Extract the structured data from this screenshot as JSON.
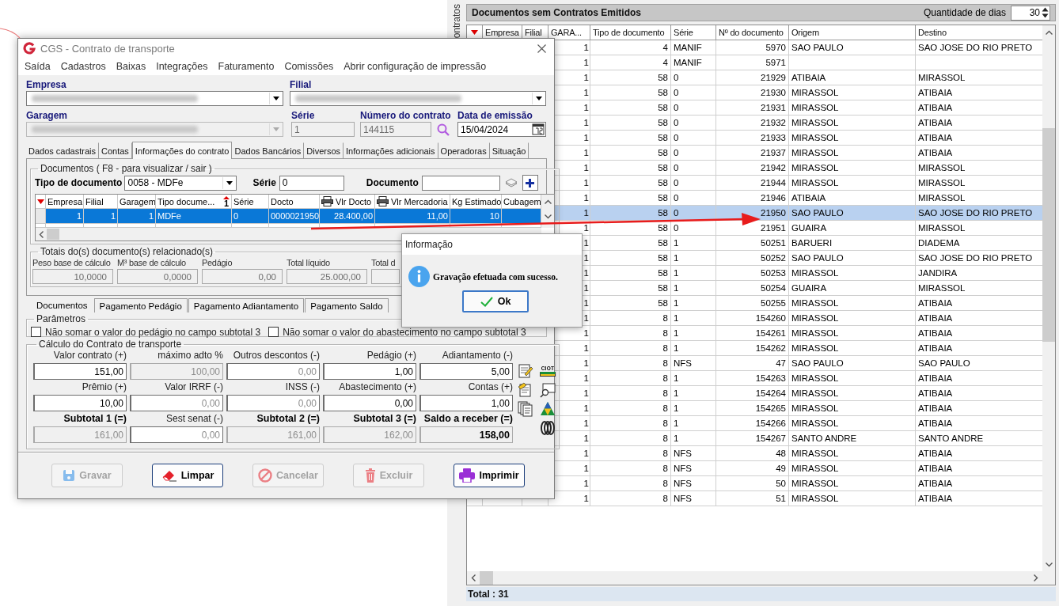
{
  "documents_window": {
    "side_label": "ontratos",
    "title": "Documentos sem Contratos Emitidos",
    "days_label": "Quantidade de dias",
    "days_value": "30",
    "columns": [
      "Empresa",
      "Filial",
      "GARA...",
      "Tipo de documento",
      "Série",
      "Nº do documento",
      "Origem",
      "Destino"
    ],
    "rows": [
      {
        "garagem": "1",
        "tipo": "4",
        "serie": "MANIF",
        "numero": "5970",
        "origem": "SAO PAULO",
        "destino": "SAO JOSE DO RIO PRETO",
        "selected": false
      },
      {
        "garagem": "1",
        "tipo": "4",
        "serie": "MANIF",
        "numero": "5971",
        "selected": false
      },
      {
        "garagem": "1",
        "tipo": "58",
        "serie": "0",
        "numero": "21929",
        "origem": "ATIBAIA",
        "destino": "MIRASSOL",
        "selected": false
      },
      {
        "garagem": "1",
        "tipo": "58",
        "serie": "0",
        "numero": "21930",
        "origem": "MIRASSOL",
        "destino": "ATIBAIA",
        "selected": false
      },
      {
        "garagem": "1",
        "tipo": "58",
        "serie": "0",
        "numero": "21931",
        "origem": "MIRASSOL",
        "destino": "ATIBAIA",
        "selected": false
      },
      {
        "garagem": "1",
        "tipo": "58",
        "serie": "0",
        "numero": "21932",
        "origem": "MIRASSOL",
        "destino": "ATIBAIA",
        "selected": false
      },
      {
        "garagem": "1",
        "tipo": "58",
        "serie": "0",
        "numero": "21933",
        "origem": "MIRASSOL",
        "destino": "ATIBAIA",
        "selected": false
      },
      {
        "garagem": "1",
        "tipo": "58",
        "serie": "0",
        "numero": "21937",
        "origem": "MIRASSOL",
        "destino": "ATIBAIA",
        "selected": false
      },
      {
        "garagem": "1",
        "tipo": "58",
        "serie": "0",
        "numero": "21942",
        "origem": "MIRASSOL",
        "destino": "MIRASSOL",
        "selected": false
      },
      {
        "garagem": "1",
        "tipo": "58",
        "serie": "0",
        "numero": "21944",
        "origem": "MIRASSOL",
        "destino": "MIRASSOL",
        "selected": false
      },
      {
        "garagem": "1",
        "tipo": "58",
        "serie": "0",
        "numero": "21946",
        "origem": "ATIBAIA",
        "destino": "MIRASSOL",
        "selected": false
      },
      {
        "garagem": "1",
        "tipo": "58",
        "serie": "0",
        "numero": "21950",
        "origem": "SAO PAULO",
        "destino": "SAO JOSE DO RIO PRETO",
        "selected": true
      },
      {
        "garagem": "1",
        "tipo": "58",
        "serie": "0",
        "numero": "21951",
        "origem": "GUAIRA",
        "destino": "MIRASSOL",
        "selected": false
      },
      {
        "garagem": "1",
        "tipo": "58",
        "serie": "1",
        "numero": "50251",
        "origem": "BARUERI",
        "destino": "DIADEMA",
        "selected": false
      },
      {
        "garagem": "1",
        "tipo": "58",
        "serie": "1",
        "numero": "50252",
        "origem": "SAO PAULO",
        "destino": "SAO JOSE DO RIO PRETO",
        "selected": false
      },
      {
        "garagem": "1",
        "tipo": "58",
        "serie": "1",
        "numero": "50253",
        "origem": "MIRASSOL",
        "destino": "JANDIRA",
        "selected": false
      },
      {
        "garagem": "1",
        "tipo": "58",
        "serie": "1",
        "numero": "50254",
        "origem": "GUAIRA",
        "destino": "MIRASSOL",
        "selected": false
      },
      {
        "garagem": "1",
        "tipo": "58",
        "serie": "1",
        "numero": "50255",
        "origem": "MIRASSOL",
        "destino": "ATIBAIA",
        "selected": false
      },
      {
        "garagem": "1",
        "tipo": "8",
        "serie": "1",
        "numero": "154260",
        "origem": "MIRASSOL",
        "destino": "ATIBAIA",
        "selected": false
      },
      {
        "garagem": "1",
        "tipo": "8",
        "serie": "1",
        "numero": "154261",
        "origem": "MIRASSOL",
        "destino": "ATIBAIA",
        "selected": false
      },
      {
        "garagem": "1",
        "tipo": "8",
        "serie": "1",
        "numero": "154262",
        "origem": "MIRASSOL",
        "destino": "ATIBAIA",
        "selected": false
      },
      {
        "garagem": "1",
        "tipo": "8",
        "serie": "NFS",
        "numero": "47",
        "origem": "SAO PAULO",
        "destino": "SAO PAULO",
        "selected": false
      },
      {
        "garagem": "1",
        "tipo": "8",
        "serie": "1",
        "numero": "154263",
        "origem": "MIRASSOL",
        "destino": "ATIBAIA",
        "selected": false
      },
      {
        "garagem": "1",
        "tipo": "8",
        "serie": "1",
        "numero": "154264",
        "origem": "MIRASSOL",
        "destino": "ATIBAIA",
        "selected": false
      },
      {
        "garagem": "1",
        "tipo": "8",
        "serie": "1",
        "numero": "154265",
        "origem": "MIRASSOL",
        "destino": "ATIBAIA",
        "selected": false
      },
      {
        "garagem": "1",
        "tipo": "8",
        "serie": "1",
        "numero": "154266",
        "origem": "MIRASSOL",
        "destino": "ATIBAIA",
        "selected": false
      },
      {
        "garagem": "1",
        "tipo": "8",
        "serie": "1",
        "numero": "154267",
        "origem": "SANTO ANDRE",
        "destino": "SANTO ANDRE",
        "selected": false
      },
      {
        "garagem": "1",
        "tipo": "8",
        "serie": "NFS",
        "numero": "48",
        "origem": "MIRASSOL",
        "destino": "ATIBAIA",
        "selected": false
      },
      {
        "garagem": "1",
        "tipo": "8",
        "serie": "NFS",
        "numero": "49",
        "origem": "MIRASSOL",
        "destino": "ATIBAIA",
        "selected": false
      },
      {
        "garagem": "1",
        "tipo": "8",
        "serie": "NFS",
        "numero": "50",
        "origem": "MIRASSOL",
        "destino": "ATIBAIA",
        "selected": false
      },
      {
        "garagem": "1",
        "tipo": "8",
        "serie": "NFS",
        "numero": "51",
        "origem": "MIRASSOL",
        "destino": "ATIBAIA",
        "selected": false
      }
    ],
    "total": "Total : 31"
  },
  "contract_window": {
    "title": "CGS - Contrato de transporte",
    "menu": [
      "Saída",
      "Cadastros",
      "Baixas",
      "Integrações",
      "Faturamento",
      "Comissões",
      "Abrir configuração de impressão"
    ],
    "header": {
      "empresa_label": "Empresa",
      "filial_label": "Filial",
      "garagem_label": "Garagem",
      "serie_label": "Série",
      "serie_value": "1",
      "numero_label": "Número do contrato",
      "numero_value": "144115",
      "data_label": "Data de emissão",
      "data_value": "15/04/2024"
    },
    "tabs": [
      {
        "label": "Dados cadastrais",
        "selected": false
      },
      {
        "label": "Contas",
        "selected": false
      },
      {
        "label": "Informações do contrato",
        "selected": true
      },
      {
        "label": "Dados Bancários",
        "selected": false
      },
      {
        "label": "Diversos",
        "selected": false
      },
      {
        "label": "Informações adicionais",
        "selected": false
      },
      {
        "label": "Operadoras",
        "selected": false
      },
      {
        "label": "Situação",
        "selected": false
      }
    ],
    "documentos": {
      "legend": "Documentos ( F8 - para visualizar / sair )",
      "tipo_label": "Tipo de documento",
      "tipo_value": "0058 - MDFe",
      "serie_label": "Série",
      "serie_value": "0",
      "documento_label": "Documento"
    },
    "grid": {
      "columns": [
        {
          "label": "Empresa",
          "kind": "plain"
        },
        {
          "label": "Filial",
          "kind": "plain"
        },
        {
          "label": "Garagem",
          "kind": "plain"
        },
        {
          "label": "Tipo docume...",
          "kind": "sorted",
          "sort_mark": "1"
        },
        {
          "label": "Série",
          "kind": "plain"
        },
        {
          "label": "Docto",
          "kind": "plain"
        },
        {
          "label": "Vlr Docto",
          "kind": "printable"
        },
        {
          "label": "Vlr Mercadoria",
          "kind": "printable"
        },
        {
          "label": "Kg Estimado",
          "kind": "plain"
        },
        {
          "label": "Cubagem",
          "kind": "plain"
        }
      ],
      "rows": [
        {
          "selected": true,
          "cells": [
            "1",
            "1",
            "1",
            "MDFe",
            "0",
            "0000021950",
            "28.400,00",
            "11,00",
            "10"
          ]
        }
      ]
    },
    "totais": {
      "legend": "Totais do(s) documento(s) relacionado(s)",
      "items": [
        {
          "label": "Peso base de cálculo",
          "value": "10,0000"
        },
        {
          "label": "M³ base de cálculo",
          "value": "0,0000"
        },
        {
          "label": "Pedágio",
          "value": "0,00"
        },
        {
          "label": "Total líquido",
          "value": "25.000,00"
        },
        {
          "label": "Total d"
        }
      ]
    },
    "sub_tabs": [
      {
        "label": "Documentos",
        "selected": true
      },
      {
        "label": "Pagamento Pedágio",
        "selected": false
      },
      {
        "label": "Pagamento Adiantamento",
        "selected": false
      },
      {
        "label": "Pagamento Saldo",
        "selected": false
      }
    ],
    "parametros": {
      "legend": "Parâmetros",
      "options": [
        {
          "label": "Não somar o valor do pedágio no campo subtotal 3",
          "checked": false
        },
        {
          "label": "Não somar o valor do abastecimento no campo subtotal 3",
          "checked": false
        }
      ]
    },
    "calculo": {
      "legend": "Cálculo do Contrato de transporte",
      "ciot_label": "CIOT",
      "fields": [
        {
          "label": "Valor contrato (+)",
          "value": "151,00",
          "disabled": false,
          "dimmed": false,
          "bold_label": false,
          "bold_value": false
        },
        {
          "label": "máximo adto %",
          "value": "100,00",
          "disabled": true,
          "dimmed": true,
          "bold_label": false,
          "bold_value": false
        },
        {
          "label": "Outros descontos (-)",
          "value": "0,00",
          "disabled": false,
          "dimmed": true,
          "bold_label": false,
          "bold_value": false
        },
        {
          "label": "Pedágio (+)",
          "value": "1,00",
          "disabled": false,
          "dimmed": false,
          "bold_label": false,
          "bold_value": false
        },
        {
          "label": "Adiantamento (-)",
          "value": "5,00",
          "disabled": false,
          "dimmed": false,
          "bold_label": false,
          "bold_value": false
        },
        {
          "label": "Prêmio (+)",
          "value": "10,00",
          "disabled": false,
          "dimmed": false,
          "bold_label": false,
          "bold_value": false
        },
        {
          "label": "Valor IRRF (-)",
          "value": "0,00",
          "disabled": false,
          "dimmed": true,
          "bold_label": false,
          "bold_value": false
        },
        {
          "label": "INSS (-)",
          "value": "0,00",
          "disabled": false,
          "dimmed": true,
          "bold_label": false,
          "bold_value": false
        },
        {
          "label": "Abastecimento (+)",
          "value": "0,00",
          "disabled": false,
          "dimmed": false,
          "bold_label": false,
          "bold_value": false
        },
        {
          "label": "Contas (+)",
          "value": "1,00",
          "disabled": false,
          "dimmed": false,
          "bold_label": false,
          "bold_value": false
        },
        {
          "label": "Subtotal 1 (=)",
          "value": "161,00",
          "disabled": true,
          "dimmed": true,
          "bold_label": true,
          "bold_value": false
        },
        {
          "label": "Sest senat (-)",
          "value": "0,00",
          "disabled": false,
          "dimmed": true,
          "bold_label": false,
          "bold_value": false
        },
        {
          "label": "Subtotal 2 (=)",
          "value": "161,00",
          "disabled": true,
          "dimmed": true,
          "bold_label": true,
          "bold_value": false
        },
        {
          "label": "Subtotal 3 (=)",
          "value": "162,00",
          "disabled": true,
          "dimmed": true,
          "bold_label": true,
          "bold_value": false
        },
        {
          "label": "Saldo a receber (=)",
          "value": "158,00",
          "disabled": true,
          "dimmed": false,
          "bold_label": true,
          "bold_value": true
        }
      ]
    },
    "buttons": [
      {
        "label": "Gravar",
        "disabled": true
      },
      {
        "label": "Limpar",
        "disabled": false
      },
      {
        "label": "Cancelar",
        "disabled": true
      },
      {
        "label": "Excluir",
        "disabled": true
      },
      {
        "label": "Imprimir",
        "disabled": false
      }
    ]
  },
  "dialog": {
    "title": "Informação",
    "message": "Gravação efetuada com sucesso.",
    "button": "Ok"
  }
}
